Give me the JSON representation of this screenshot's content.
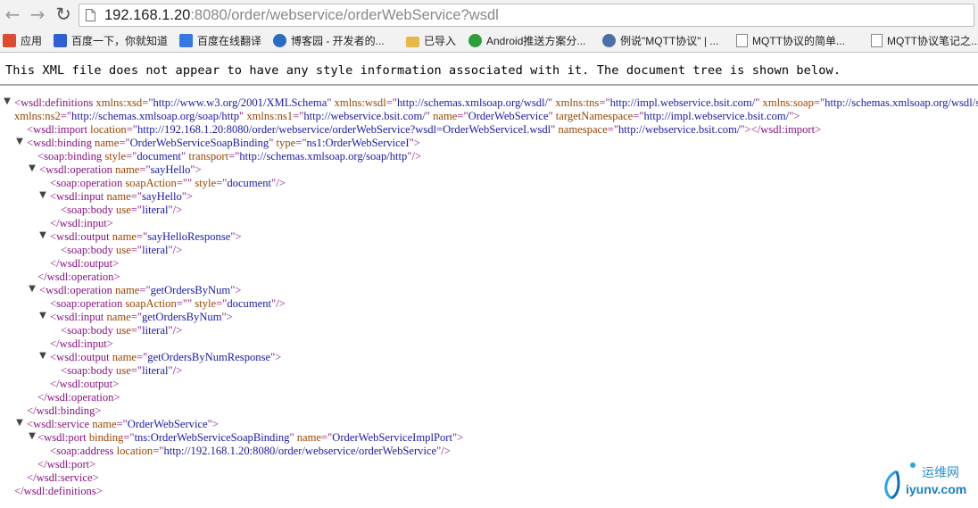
{
  "browser": {
    "url_host": "192.168.1.20",
    "url_rest": ":8080/order/webservice/orderWebService?wsdl",
    "icons": {
      "back": "back-arrow-icon",
      "forward": "forward-arrow-icon",
      "reload": "reload-icon",
      "page": "page-icon"
    }
  },
  "bookmarks": [
    {
      "label": "应用",
      "icon": "apps-grid-icon",
      "color": "#e04a2f"
    },
    {
      "label": "百度一下，你就知道",
      "icon": "baidu-paw-icon",
      "color": "#2f5fd4"
    },
    {
      "label": "百度在线翻译",
      "icon": "translate-icon",
      "color": "#3577e5"
    },
    {
      "label": "博客园 - 开发者的...",
      "icon": "cnblogs-icon",
      "color": "#2a6cc4"
    },
    {
      "label": "已导入",
      "icon": "folder-icon",
      "color": "#e6b84a"
    },
    {
      "label": "Android推送方案分...",
      "icon": "refresh-green-icon",
      "color": "#2e9e3a"
    },
    {
      "label": "例说\"MQTT协议\" | ...",
      "icon": "globe-icon",
      "color": "#4b6fa8"
    },
    {
      "label": "MQTT协议的简单...",
      "icon": "page-icon",
      "color": "#ffffff"
    },
    {
      "label": "MQTT协议笔记之...",
      "icon": "page-icon",
      "color": "#ffffff"
    }
  ],
  "notice": "This XML file does not appear to have any style information associated with it. The document tree is shown below.",
  "xml_lines": [
    {
      "tw": true,
      "segs": [
        {
          "c": "t",
          "s": "<wsdl:definitions "
        },
        {
          "c": "a",
          "s": "xmlns:xsd"
        },
        {
          "c": "t",
          "s": "=\""
        },
        {
          "c": "v",
          "s": "http://www.w3.org/2001/XMLSchema"
        },
        {
          "c": "t",
          "s": "\" "
        },
        {
          "c": "a",
          "s": "xmlns:wsdl"
        },
        {
          "c": "t",
          "s": "=\""
        },
        {
          "c": "v",
          "s": "http://schemas.xmlsoap.org/wsdl/"
        },
        {
          "c": "t",
          "s": "\" "
        },
        {
          "c": "a",
          "s": "xmlns:tns"
        },
        {
          "c": "t",
          "s": "=\""
        },
        {
          "c": "v",
          "s": "http://impl.webservice.bsit.com/"
        },
        {
          "c": "t",
          "s": "\" "
        },
        {
          "c": "a",
          "s": "xmlns:soap"
        },
        {
          "c": "t",
          "s": "=\""
        },
        {
          "c": "v",
          "s": "http://schemas.xmlsoap.org/wsdl/soap/"
        }
      ]
    },
    {
      "segs": [
        {
          "c": "a",
          "s": "xmlns:ns2"
        },
        {
          "c": "t",
          "s": "=\""
        },
        {
          "c": "v",
          "s": "http://schemas.xmlsoap.org/soap/http"
        },
        {
          "c": "t",
          "s": "\" "
        },
        {
          "c": "a",
          "s": "xmlns:ns1"
        },
        {
          "c": "t",
          "s": "=\""
        },
        {
          "c": "v",
          "s": "http://webservice.bsit.com/"
        },
        {
          "c": "t",
          "s": "\" "
        },
        {
          "c": "a",
          "s": "name"
        },
        {
          "c": "t",
          "s": "=\""
        },
        {
          "c": "v",
          "s": "OrderWebService"
        },
        {
          "c": "t",
          "s": "\" "
        },
        {
          "c": "a",
          "s": "targetNamespace"
        },
        {
          "c": "t",
          "s": "=\""
        },
        {
          "c": "v",
          "s": "http://impl.webservice.bsit.com/"
        },
        {
          "c": "t",
          "s": "\">"
        }
      ]
    },
    {
      "segs": [
        {
          "c": "t",
          "s": "<wsdl:import "
        },
        {
          "c": "a",
          "s": "location"
        },
        {
          "c": "t",
          "s": "=\""
        },
        {
          "c": "v",
          "s": "http://192.168.1.20:8080/order/webservice/orderWebService?wsdl=OrderWebServiceI.wsdl"
        },
        {
          "c": "t",
          "s": "\" "
        },
        {
          "c": "a",
          "s": "namespace"
        },
        {
          "c": "t",
          "s": "=\""
        },
        {
          "c": "v",
          "s": "http://webservice.bsit.com/"
        },
        {
          "c": "t",
          "s": "\"></wsdl:import>"
        }
      ]
    },
    {
      "tw": true,
      "segs": [
        {
          "c": "t",
          "s": "<wsdl:binding "
        },
        {
          "c": "a",
          "s": "name"
        },
        {
          "c": "t",
          "s": "=\""
        },
        {
          "c": "v",
          "s": "OrderWebServiceSoapBinding"
        },
        {
          "c": "t",
          "s": "\" "
        },
        {
          "c": "a",
          "s": "type"
        },
        {
          "c": "t",
          "s": "=\""
        },
        {
          "c": "v",
          "s": "ns1:OrderWebServiceI"
        },
        {
          "c": "t",
          "s": "\">"
        }
      ]
    },
    {
      "segs": [
        {
          "c": "t",
          "s": "<soap:binding "
        },
        {
          "c": "a",
          "s": "style"
        },
        {
          "c": "t",
          "s": "=\""
        },
        {
          "c": "v",
          "s": "document"
        },
        {
          "c": "t",
          "s": "\" "
        },
        {
          "c": "a",
          "s": "transport"
        },
        {
          "c": "t",
          "s": "=\""
        },
        {
          "c": "v",
          "s": "http://schemas.xmlsoap.org/soap/http"
        },
        {
          "c": "t",
          "s": "\"/>"
        }
      ]
    },
    {
      "tw": true,
      "segs": [
        {
          "c": "t",
          "s": "<wsdl:operation "
        },
        {
          "c": "a",
          "s": "name"
        },
        {
          "c": "t",
          "s": "=\""
        },
        {
          "c": "v",
          "s": "sayHello"
        },
        {
          "c": "t",
          "s": "\">"
        }
      ]
    },
    {
      "segs": [
        {
          "c": "t",
          "s": "<soap:operation "
        },
        {
          "c": "a",
          "s": "soapAction"
        },
        {
          "c": "t",
          "s": "=\"\" "
        },
        {
          "c": "a",
          "s": "style"
        },
        {
          "c": "t",
          "s": "=\""
        },
        {
          "c": "v",
          "s": "document"
        },
        {
          "c": "t",
          "s": "\"/>"
        }
      ]
    },
    {
      "tw": true,
      "segs": [
        {
          "c": "t",
          "s": "<wsdl:input "
        },
        {
          "c": "a",
          "s": "name"
        },
        {
          "c": "t",
          "s": "=\""
        },
        {
          "c": "v",
          "s": "sayHello"
        },
        {
          "c": "t",
          "s": "\">"
        }
      ]
    },
    {
      "segs": [
        {
          "c": "t",
          "s": "<soap:body "
        },
        {
          "c": "a",
          "s": "use"
        },
        {
          "c": "t",
          "s": "=\""
        },
        {
          "c": "v",
          "s": "literal"
        },
        {
          "c": "t",
          "s": "\"/>"
        }
      ]
    },
    {
      "segs": [
        {
          "c": "t",
          "s": "</wsdl:input>"
        }
      ]
    },
    {
      "tw": true,
      "segs": [
        {
          "c": "t",
          "s": "<wsdl:output "
        },
        {
          "c": "a",
          "s": "name"
        },
        {
          "c": "t",
          "s": "=\""
        },
        {
          "c": "v",
          "s": "sayHelloResponse"
        },
        {
          "c": "t",
          "s": "\">"
        }
      ]
    },
    {
      "segs": [
        {
          "c": "t",
          "s": "<soap:body "
        },
        {
          "c": "a",
          "s": "use"
        },
        {
          "c": "t",
          "s": "=\""
        },
        {
          "c": "v",
          "s": "literal"
        },
        {
          "c": "t",
          "s": "\"/>"
        }
      ]
    },
    {
      "segs": [
        {
          "c": "t",
          "s": "</wsdl:output>"
        }
      ]
    },
    {
      "segs": [
        {
          "c": "t",
          "s": "</wsdl:operation>"
        }
      ]
    },
    {
      "tw": true,
      "segs": [
        {
          "c": "t",
          "s": "<wsdl:operation "
        },
        {
          "c": "a",
          "s": "name"
        },
        {
          "c": "t",
          "s": "=\""
        },
        {
          "c": "v",
          "s": "getOrdersByNum"
        },
        {
          "c": "t",
          "s": "\">"
        }
      ]
    },
    {
      "segs": [
        {
          "c": "t",
          "s": "<soap:operation "
        },
        {
          "c": "a",
          "s": "soapAction"
        },
        {
          "c": "t",
          "s": "=\"\" "
        },
        {
          "c": "a",
          "s": "style"
        },
        {
          "c": "t",
          "s": "=\""
        },
        {
          "c": "v",
          "s": "document"
        },
        {
          "c": "t",
          "s": "\"/>"
        }
      ]
    },
    {
      "tw": true,
      "segs": [
        {
          "c": "t",
          "s": "<wsdl:input "
        },
        {
          "c": "a",
          "s": "name"
        },
        {
          "c": "t",
          "s": "=\""
        },
        {
          "c": "v",
          "s": "getOrdersByNum"
        },
        {
          "c": "t",
          "s": "\">"
        }
      ]
    },
    {
      "segs": [
        {
          "c": "t",
          "s": "<soap:body "
        },
        {
          "c": "a",
          "s": "use"
        },
        {
          "c": "t",
          "s": "=\""
        },
        {
          "c": "v",
          "s": "literal"
        },
        {
          "c": "t",
          "s": "\"/>"
        }
      ]
    },
    {
      "segs": [
        {
          "c": "t",
          "s": "</wsdl:input>"
        }
      ]
    },
    {
      "tw": true,
      "segs": [
        {
          "c": "t",
          "s": "<wsdl:output "
        },
        {
          "c": "a",
          "s": "name"
        },
        {
          "c": "t",
          "s": "=\""
        },
        {
          "c": "v",
          "s": "getOrdersByNumResponse"
        },
        {
          "c": "t",
          "s": "\">"
        }
      ]
    },
    {
      "segs": [
        {
          "c": "t",
          "s": "<soap:body "
        },
        {
          "c": "a",
          "s": "use"
        },
        {
          "c": "t",
          "s": "=\""
        },
        {
          "c": "v",
          "s": "literal"
        },
        {
          "c": "t",
          "s": "\"/>"
        }
      ]
    },
    {
      "segs": [
        {
          "c": "t",
          "s": "</wsdl:output>"
        }
      ]
    },
    {
      "segs": [
        {
          "c": "t",
          "s": "</wsdl:operation>"
        }
      ]
    },
    {
      "segs": [
        {
          "c": "t",
          "s": "</wsdl:binding>"
        }
      ]
    },
    {
      "tw": true,
      "segs": [
        {
          "c": "t",
          "s": "<wsdl:service "
        },
        {
          "c": "a",
          "s": "name"
        },
        {
          "c": "t",
          "s": "=\""
        },
        {
          "c": "v",
          "s": "OrderWebService"
        },
        {
          "c": "t",
          "s": "\">"
        }
      ]
    },
    {
      "tw": true,
      "segs": [
        {
          "c": "t",
          "s": "<wsdl:port "
        },
        {
          "c": "a",
          "s": "binding"
        },
        {
          "c": "t",
          "s": "=\""
        },
        {
          "c": "v",
          "s": "tns:OrderWebServiceSoapBinding"
        },
        {
          "c": "t",
          "s": "\" "
        },
        {
          "c": "a",
          "s": "name"
        },
        {
          "c": "t",
          "s": "=\""
        },
        {
          "c": "v",
          "s": "OrderWebServiceImplPort"
        },
        {
          "c": "t",
          "s": "\">"
        }
      ]
    },
    {
      "segs": [
        {
          "c": "t",
          "s": "<soap:address "
        },
        {
          "c": "a",
          "s": "location"
        },
        {
          "c": "t",
          "s": "=\""
        },
        {
          "c": "v",
          "s": "http://192.168.1.20:8080/order/webservice/orderWebService"
        },
        {
          "c": "t",
          "s": "\"/>"
        }
      ]
    },
    {
      "segs": [
        {
          "c": "t",
          "s": "</wsdl:port>"
        }
      ]
    },
    {
      "segs": [
        {
          "c": "t",
          "s": "</wsdl:service>"
        }
      ]
    },
    {
      "segs": [
        {
          "c": "t",
          "s": "</wsdl:definitions>"
        }
      ]
    }
  ],
  "watermark": {
    "cn": "运维网",
    "en": "iyunv.com"
  }
}
